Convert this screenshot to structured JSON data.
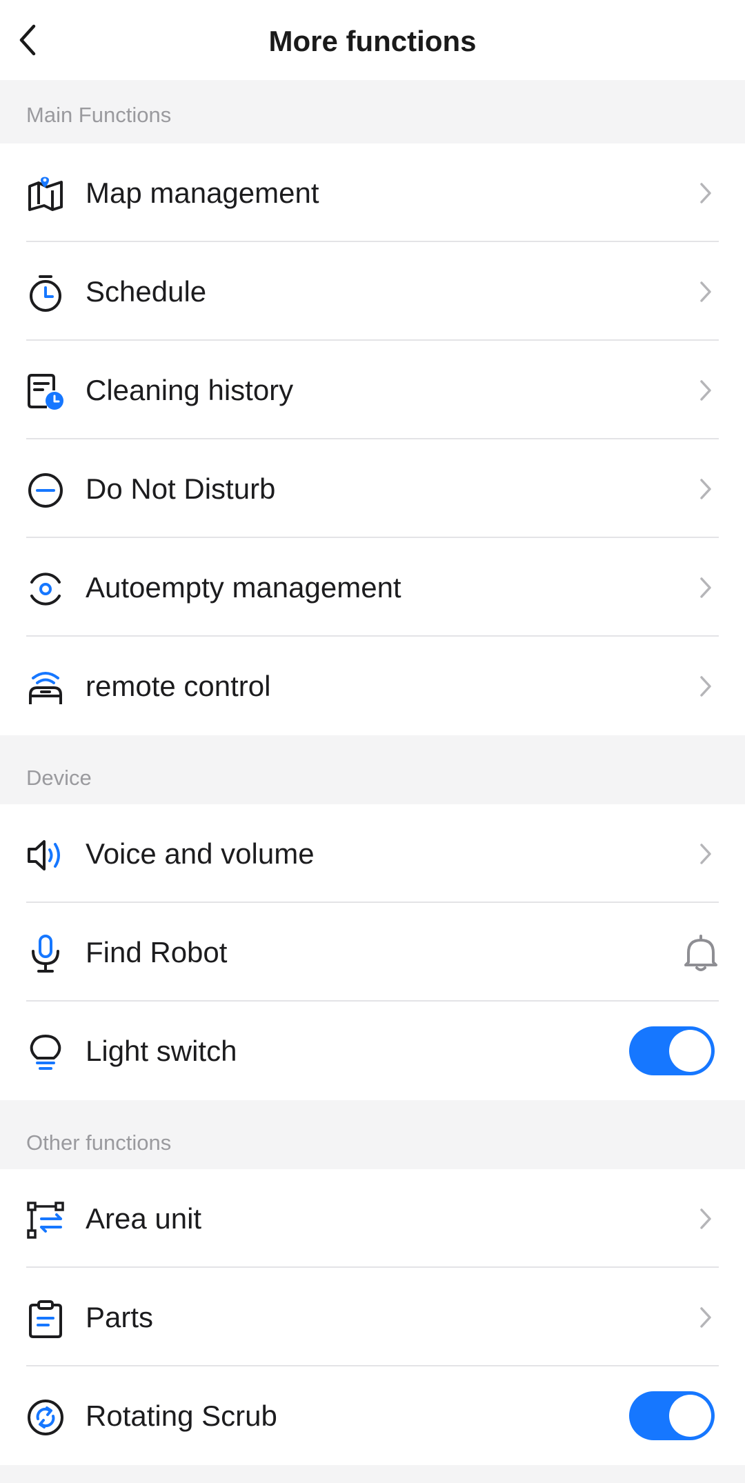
{
  "header": {
    "title": "More functions"
  },
  "sections": {
    "main": {
      "label": "Main Functions",
      "items": [
        {
          "label": "Map management",
          "icon": "map-icon",
          "control": "chevron"
        },
        {
          "label": "Schedule",
          "icon": "timer-icon",
          "control": "chevron"
        },
        {
          "label": "Cleaning history",
          "icon": "history-icon",
          "control": "chevron"
        },
        {
          "label": "Do Not Disturb",
          "icon": "do-not-disturb-icon",
          "control": "chevron"
        },
        {
          "label": "Autoempty management",
          "icon": "autoempty-icon",
          "control": "chevron"
        },
        {
          "label": "remote control",
          "icon": "remote-control-icon",
          "control": "chevron"
        }
      ]
    },
    "device": {
      "label": "Device",
      "items": [
        {
          "label": "Voice and volume",
          "icon": "speaker-icon",
          "control": "chevron"
        },
        {
          "label": "Find Robot",
          "icon": "microphone-icon",
          "control": "bell"
        },
        {
          "label": "Light switch",
          "icon": "lightbulb-icon",
          "control": "toggle",
          "on": true
        }
      ]
    },
    "other": {
      "label": "Other functions",
      "items": [
        {
          "label": "Area unit",
          "icon": "area-unit-icon",
          "control": "chevron"
        },
        {
          "label": "Parts",
          "icon": "clipboard-icon",
          "control": "chevron"
        },
        {
          "label": "Rotating Scrub",
          "icon": "rotate-icon",
          "control": "toggle",
          "on": true
        }
      ]
    }
  },
  "colors": {
    "accent": "#1677ff",
    "background": "#f4f4f5",
    "surface": "#ffffff",
    "text": "#1c1c1e",
    "secondary_text": "#9a9a9e",
    "divider": "#e3e3e6",
    "chevron": "#b5b5b8"
  }
}
